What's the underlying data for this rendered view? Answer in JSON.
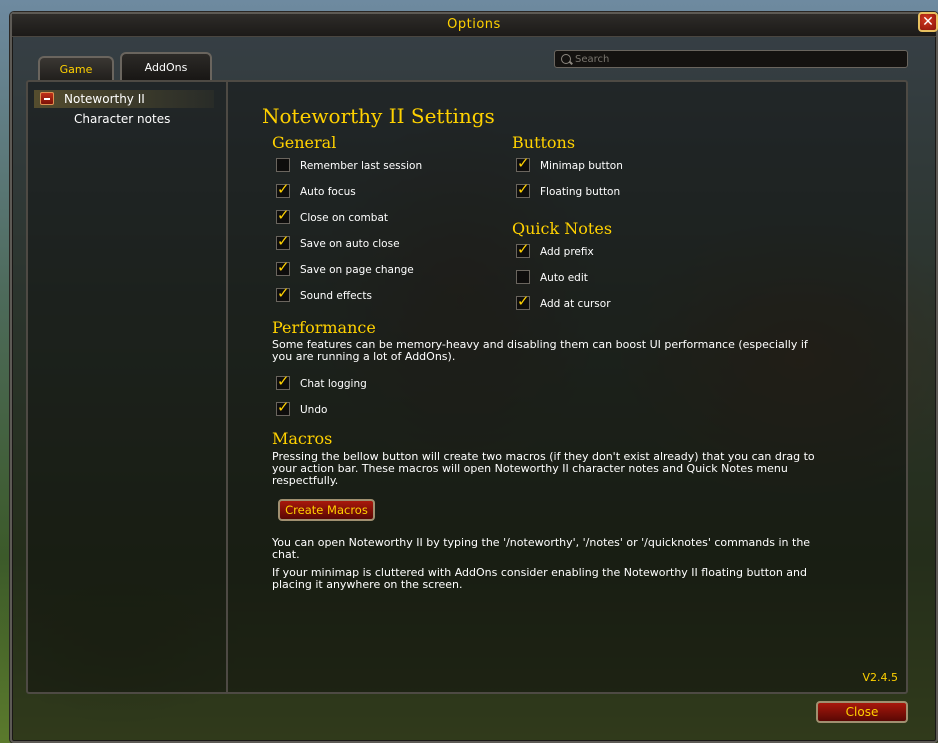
{
  "window": {
    "title": "Options",
    "close_icon": "close-x-icon"
  },
  "tabs": [
    {
      "label": "Game",
      "active": false
    },
    {
      "label": "AddOns",
      "active": true
    }
  ],
  "search": {
    "placeholder": "Search",
    "value": ""
  },
  "sidebar": {
    "items": [
      {
        "label": "Noteworthy II",
        "selected": true,
        "expanded": true
      },
      {
        "label": "Character notes",
        "selected": false
      }
    ]
  },
  "settings": {
    "title": "Noteworthy II Settings",
    "general": {
      "heading": "General",
      "options": [
        {
          "label": "Remember last session",
          "checked": false
        },
        {
          "label": "Auto focus",
          "checked": true
        },
        {
          "label": "Close on combat",
          "checked": true
        },
        {
          "label": "Save on auto close",
          "checked": true
        },
        {
          "label": "Save on page change",
          "checked": true
        },
        {
          "label": "Sound effects",
          "checked": true
        }
      ]
    },
    "buttons": {
      "heading": "Buttons",
      "options": [
        {
          "label": "Minimap button",
          "checked": true
        },
        {
          "label": "Floating button",
          "checked": true
        }
      ]
    },
    "quick_notes": {
      "heading": "Quick Notes",
      "options": [
        {
          "label": "Add prefix",
          "checked": true
        },
        {
          "label": "Auto edit",
          "checked": false
        },
        {
          "label": "Add at cursor",
          "checked": true
        }
      ]
    },
    "performance": {
      "heading": "Performance",
      "description": "Some features can be memory-heavy and disabling them can boost UI performance (especially if you are running a lot of AddOns).",
      "options": [
        {
          "label": "Chat logging",
          "checked": true
        },
        {
          "label": "Undo",
          "checked": true
        }
      ]
    },
    "macros": {
      "heading": "Macros",
      "description": "Pressing the bellow button will create two macros (if they don't exist already) that you can drag to your action bar. These macros will open Noteworthy II character notes and Quick Notes menu respectfully.",
      "button_label": "Create Macros"
    },
    "info1": "You can open Noteworthy II by typing the '/noteworthy', '/notes' or '/quicknotes' commands in the chat.",
    "info2": "If your minimap is cluttered with AddOns consider enabling the Noteworthy II floating button and placing it anywhere on the screen.",
    "version": "V2.4.5"
  },
  "footer": {
    "close_label": "Close"
  },
  "colors": {
    "accent": "#ffd100",
    "button_red": "#8a1208"
  }
}
